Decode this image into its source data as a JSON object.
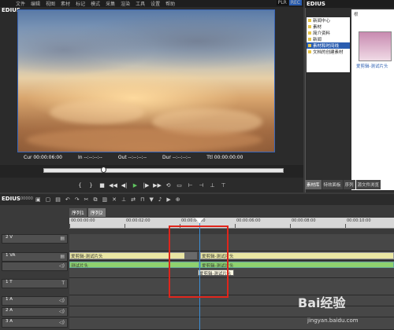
{
  "menubar": {
    "items": [
      "文件",
      "编辑",
      "视图",
      "素材",
      "标记",
      "模式",
      "采集",
      "渲染",
      "工具",
      "设置",
      "帮助"
    ],
    "plr_label": "PLR",
    "rec_label": "REC"
  },
  "player": {
    "logo": "EDIUS",
    "timecodes": [
      "Cur 00:00:06:00",
      "In --:--:--:--",
      "Out --:--:--:--",
      "Dur --:--:--:--",
      "Ttl 00:00:00:00"
    ],
    "transport": [
      "{",
      "}",
      "■",
      "◀◀",
      "◀|",
      "▶",
      "|▶",
      "▶▶",
      "⟲",
      "▭",
      "⊢",
      "⊣",
      "⊥",
      "⊤"
    ]
  },
  "bin": {
    "logo": "EDIUS",
    "folder_label": "根",
    "tree": [
      "新闻中心",
      "素材",
      "简介资料",
      "新闻",
      "素材和时间线",
      "文档的创建素材"
    ],
    "selected_index": 4,
    "thumb_label": "爱剪辑-测试片头",
    "tabs": [
      "素材库",
      "特效面板",
      "序列",
      "源文件浏览"
    ],
    "active_tab": 0
  },
  "timeline": {
    "logo": "EDIUS",
    "timecode": "00000",
    "tabs": [
      "序列1",
      "序列2"
    ],
    "active_tab": 1,
    "ruler_labels": [
      "00:00:00:00",
      "00:00:02:00",
      "00:00:04:00",
      "00:00:06:00",
      "00:00:08:00",
      "00:00:10:00"
    ],
    "track_headers": [
      {
        "label": "2 V",
        "icon": "▤"
      },
      {
        "label": "1 VA",
        "icon": "▤"
      },
      {
        "label": "",
        "icon": "◁)"
      },
      {
        "label": "1 T",
        "icon": "T"
      },
      {
        "label": "1 A",
        "icon": "◁)"
      },
      {
        "label": "2 A",
        "icon": "◁)"
      },
      {
        "label": "3 A",
        "icon": "◁)"
      }
    ],
    "clips": {
      "v_left": "爱剪辑-测试片头",
      "v_right": "爱剪辑-测试片头",
      "a_left": "测试片头",
      "a_right": "爱剪辑-测试片头"
    },
    "tooltip": "爱剪辑-测试片头"
  },
  "watermark": {
    "text": "Bai经验",
    "url": "jingyan.baidu.com"
  },
  "colors": {
    "highlight": "#e0251b",
    "cursor": "#3b8ed6",
    "video_clip": "#e9e6a3",
    "audio_clip": "#8fd16e"
  }
}
